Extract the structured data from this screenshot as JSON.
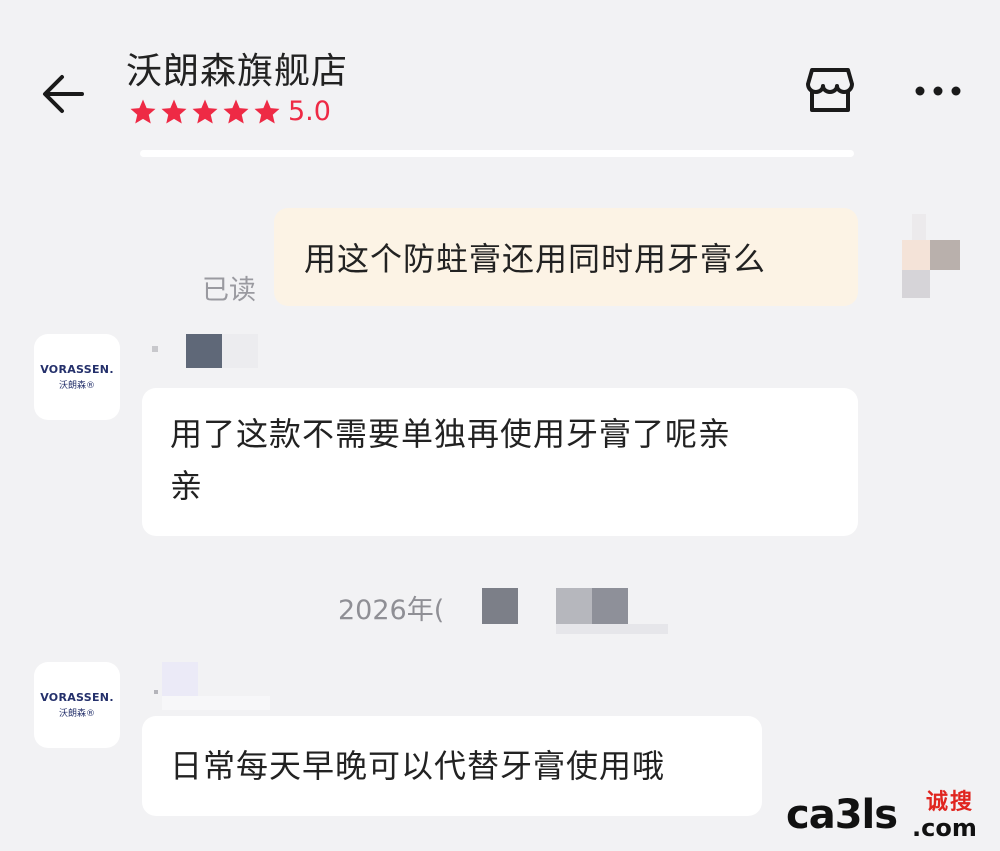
{
  "header": {
    "back_icon": "arrow-left-icon",
    "shop_name": "沃朗森旗舰店",
    "rating_stars": 5,
    "rating_score": "5.0",
    "rating_color": "#ee2a45",
    "store_icon": "store-icon",
    "more_icon": "more-dots-icon"
  },
  "messages": {
    "outgoing_1": {
      "text": "用这个防蛀膏还用同时用牙膏么",
      "status": "已读",
      "bubble_color": "#fcf3e5"
    },
    "incoming_1": {
      "avatar_logo_en": "VORASSEN.",
      "avatar_logo_cn": "沃朗森®",
      "line1": "用了这款不需要单独再使用牙膏了呢亲",
      "line2": "亲"
    },
    "timestamp": "2026年(",
    "incoming_2": {
      "avatar_logo_en": "VORASSEN.",
      "avatar_logo_cn": "沃朗森®",
      "text": "日常每天早晚可以代替牙膏使用哦"
    }
  },
  "watermark": {
    "latin": "ca3ls",
    "cn": "诚搜",
    "domain": ".com"
  }
}
